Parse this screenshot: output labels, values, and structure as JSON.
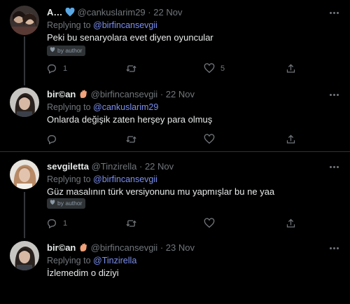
{
  "tweets": [
    {
      "name": "A…",
      "handle": "@cankuslarim29",
      "separator": "·",
      "date": "22 Nov",
      "reply_prefix": "Replying to",
      "reply_to": "@birfincansevgii",
      "text": "Peki bu senaryolara evet diyen oyuncular",
      "badge": "by author",
      "reply_count": "1",
      "like_count": "5"
    },
    {
      "name": "bir©an",
      "handle": "@birfincansevgii",
      "separator": "·",
      "date": "22 Nov",
      "reply_prefix": "Replying to",
      "reply_to": "@cankuslarim29",
      "text": "Onlarda değişik zaten herşey para olmuş",
      "reply_count": "",
      "like_count": ""
    },
    {
      "name": "sevgiletta",
      "handle": "@Tinzirella",
      "separator": "·",
      "date": "22 Nov",
      "reply_prefix": "Replying to",
      "reply_to": "@birfincansevgii",
      "text": "Güz masalının türk versiyonunu mu yapmışlar bu ne yaa",
      "badge": "by author",
      "reply_count": "1",
      "like_count": ""
    },
    {
      "name": "bir©an",
      "handle": "@birfincansevgii",
      "separator": "·",
      "date": "23 Nov",
      "reply_prefix": "Replying to",
      "reply_to": "@Tinzirella",
      "text": "İzlemedim o diziyi"
    }
  ],
  "icons": [
    "heart-emoji-icon",
    "hand-emoji-icon",
    "reply-icon",
    "retweet-icon",
    "like-icon",
    "share-icon",
    "more-icon",
    "shield-icon"
  ],
  "colors": {
    "background": "#000000",
    "text": "#e7e9ea",
    "muted": "#71767b",
    "mention": "#7b8ff0",
    "divider": "#2f3336"
  }
}
